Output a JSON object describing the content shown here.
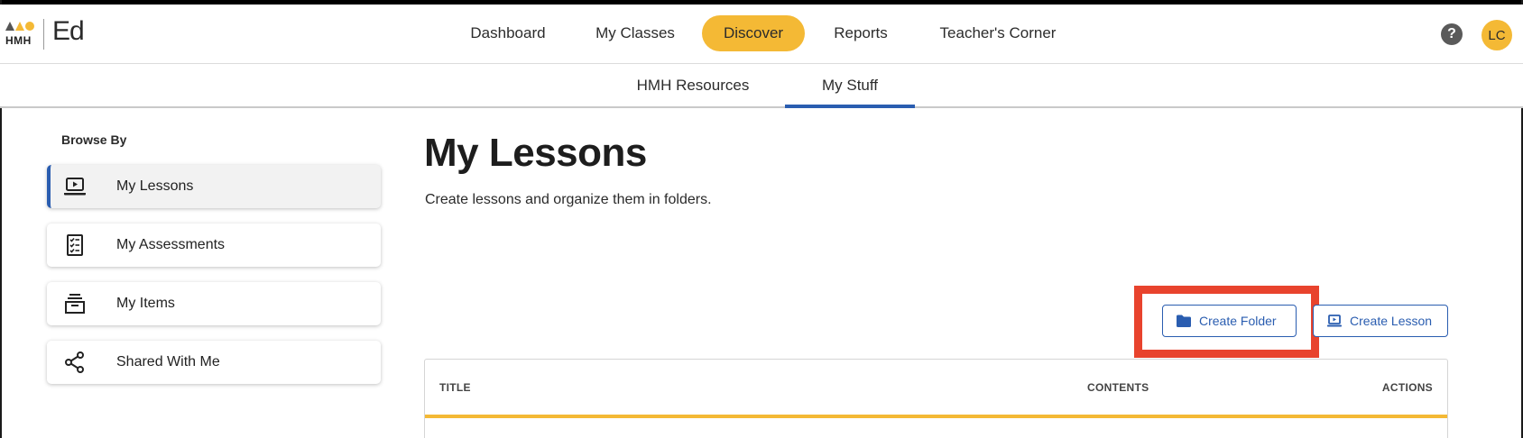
{
  "header": {
    "logo_text": "HMH",
    "brand": "Ed",
    "nav": [
      {
        "label": "Dashboard",
        "active": false
      },
      {
        "label": "My Classes",
        "active": false
      },
      {
        "label": "Discover",
        "active": true
      },
      {
        "label": "Reports",
        "active": false
      },
      {
        "label": "Teacher's Corner",
        "active": false
      }
    ],
    "help_icon": "?",
    "avatar_initials": "LC"
  },
  "subnav": {
    "tabs": [
      {
        "label": "HMH Resources",
        "active": false
      },
      {
        "label": "My Stuff",
        "active": true
      }
    ]
  },
  "sidebar": {
    "heading": "Browse By",
    "items": [
      {
        "label": "My Lessons",
        "icon": "laptop-play-icon",
        "active": true
      },
      {
        "label": "My Assessments",
        "icon": "checklist-icon",
        "active": false
      },
      {
        "label": "My Items",
        "icon": "archive-box-icon",
        "active": false
      },
      {
        "label": "Shared With Me",
        "icon": "share-icon",
        "active": false
      }
    ]
  },
  "main": {
    "title": "My Lessons",
    "subtitle": "Create lessons and organize them in folders.",
    "create_folder_label": "Create Folder",
    "create_lesson_label": "Create Lesson",
    "table": {
      "columns": [
        "TITLE",
        "CONTENTS",
        "ACTIONS"
      ]
    }
  },
  "colors": {
    "accent_yellow": "#f4b935",
    "primary_blue": "#2a5db0",
    "highlight_red": "#e8432d"
  }
}
